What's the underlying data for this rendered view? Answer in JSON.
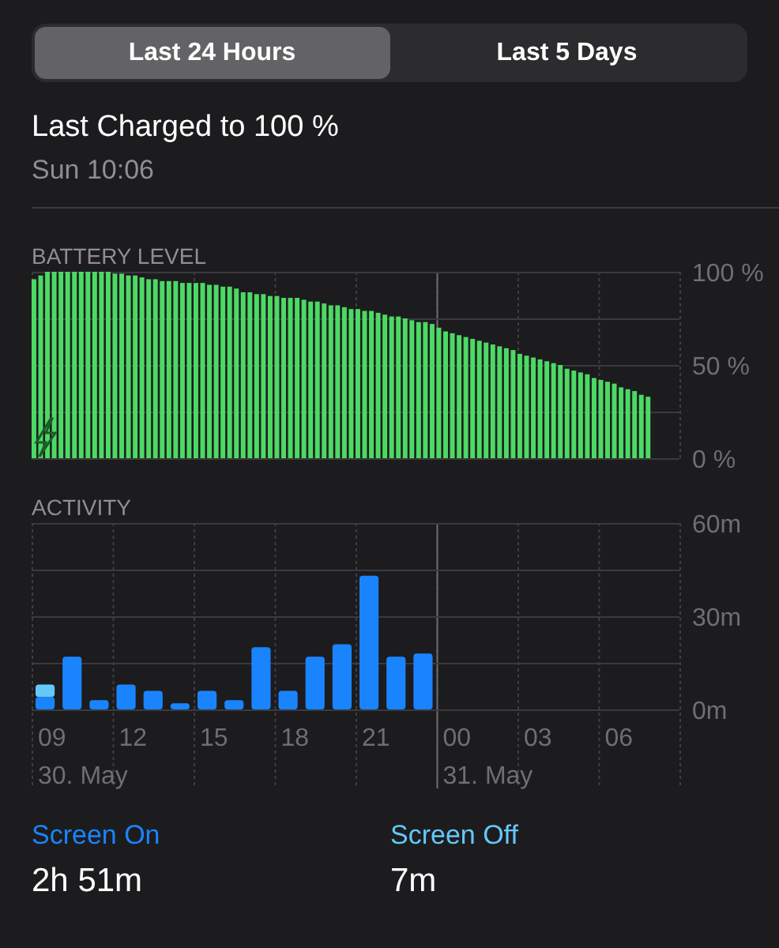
{
  "tabs": [
    {
      "label": "Last 24 Hours",
      "selected": true
    },
    {
      "label": "Last 5 Days",
      "selected": false
    }
  ],
  "last_charged": {
    "title": "Last Charged to 100 %",
    "time": "Sun 10:06"
  },
  "battery": {
    "heading": "BATTERY LEVEL",
    "charging": true,
    "chart_data": {
      "type": "bar",
      "ylim": [
        0,
        100
      ],
      "yticks": [
        {
          "value": 100,
          "label": "100 %"
        },
        {
          "value": 50,
          "label": "50 %"
        },
        {
          "value": 0,
          "label": "0 %"
        }
      ],
      "values": [
        96,
        98,
        100,
        100,
        100,
        100,
        100,
        100,
        100,
        100,
        100,
        100,
        99,
        99,
        98,
        98,
        97,
        96,
        96,
        95,
        95,
        95,
        94,
        94,
        94,
        94,
        93,
        93,
        92,
        92,
        91,
        89,
        89,
        88,
        88,
        87,
        87,
        86,
        86,
        86,
        85,
        84,
        84,
        83,
        82,
        82,
        81,
        80,
        80,
        79,
        79,
        78,
        77,
        76,
        76,
        75,
        74,
        73,
        73,
        72,
        70,
        68,
        67,
        66,
        65,
        64,
        63,
        62,
        61,
        60,
        59,
        58,
        56,
        55,
        54,
        53,
        52,
        51,
        50,
        48,
        47,
        46,
        45,
        43,
        42,
        41,
        40,
        38,
        37,
        36,
        34,
        33,
        null,
        null,
        null,
        null
      ]
    }
  },
  "activity": {
    "heading": "ACTIVITY",
    "chart_data": {
      "type": "bar",
      "stacked": true,
      "ylim": [
        0,
        60
      ],
      "yticks": [
        {
          "value": 60,
          "label": "60m"
        },
        {
          "value": 30,
          "label": "30m"
        },
        {
          "value": 0,
          "label": "0m"
        }
      ],
      "categories": [
        "09",
        null,
        null,
        "12",
        null,
        null,
        "15",
        null,
        null,
        "18",
        null,
        null,
        "21",
        null,
        null,
        "00",
        null,
        null,
        "03",
        null,
        null,
        "06",
        null,
        null
      ],
      "series": [
        {
          "name": "Screen On",
          "color": "#1a84ff",
          "values": [
            4,
            17,
            3,
            8,
            6,
            2,
            6,
            3,
            20,
            6,
            17,
            21,
            43,
            17,
            18,
            null,
            null,
            null,
            null,
            null,
            null,
            null,
            null,
            null
          ]
        },
        {
          "name": "Screen Off",
          "color": "#64c8fa",
          "values": [
            4,
            0,
            0,
            0,
            0,
            0,
            0,
            0,
            0,
            0,
            0,
            0,
            0,
            0,
            0,
            null,
            null,
            null,
            null,
            null,
            null,
            null,
            null,
            null
          ]
        }
      ]
    },
    "dates": [
      {
        "label": "30. May"
      },
      {
        "label": "31. May"
      }
    ]
  },
  "totals": [
    {
      "value": "2h 51m"
    },
    {
      "value": "7m"
    }
  ]
}
